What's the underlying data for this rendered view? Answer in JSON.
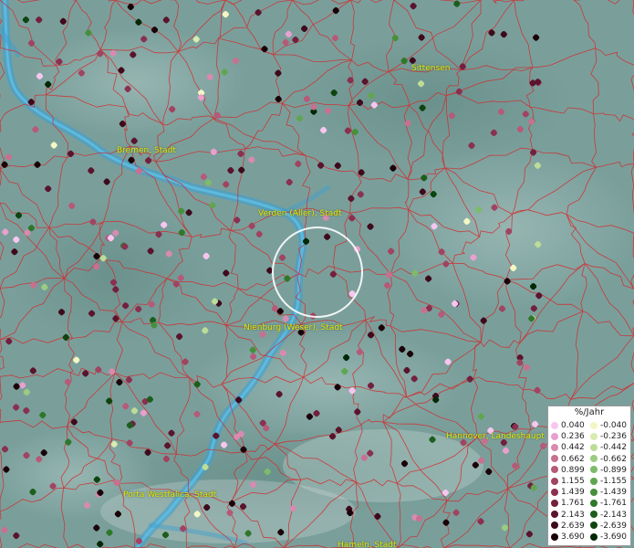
{
  "cities": [
    {
      "id": "sittensen",
      "label": "Sittensen"
    },
    {
      "id": "bremen",
      "label": "Bremen, Stadt"
    },
    {
      "id": "verden",
      "label": "Verden (Aller), Stadt"
    },
    {
      "id": "nienburg",
      "label": "Nienburg (Weser), Stadt"
    },
    {
      "id": "hannover",
      "label": "Hannover, Landeshaupt"
    },
    {
      "id": "porta",
      "label": "Porta Westfalica, Stadt"
    },
    {
      "id": "hameln",
      "label": "Hameln, Stadt"
    }
  ],
  "legend": {
    "title": "%/Jahr",
    "positive": [
      {
        "label": "0.040",
        "color": "#f7c6f0"
      },
      {
        "label": "0.236",
        "color": "#e9a0cf"
      },
      {
        "label": "0.442",
        "color": "#d98ab0"
      },
      {
        "label": "0.662",
        "color": "#c87090"
      },
      {
        "label": "0.899",
        "color": "#b55a78"
      },
      {
        "label": "1.155",
        "color": "#a04462"
      },
      {
        "label": "1.439",
        "color": "#8a3050"
      },
      {
        "label": "1.761",
        "color": "#72203e"
      },
      {
        "label": "2.143",
        "color": "#5a142e"
      },
      {
        "label": "2.639",
        "color": "#3e0a1c"
      },
      {
        "label": "3.690",
        "color": "#1a0008"
      }
    ],
    "negative": [
      {
        "label": "-0.040",
        "color": "#f4f7c4"
      },
      {
        "label": "-0.236",
        "color": "#d8ebb0"
      },
      {
        "label": "-0.442",
        "color": "#bcdc98"
      },
      {
        "label": "-0.662",
        "color": "#9ccc80"
      },
      {
        "label": "-0.899",
        "color": "#7ebb68"
      },
      {
        "label": "-1.155",
        "color": "#60a650"
      },
      {
        "label": "-1.439",
        "color": "#46903c"
      },
      {
        "label": "-1.761",
        "color": "#2e782a"
      },
      {
        "label": "-2.143",
        "color": "#1c5e1c"
      },
      {
        "label": "-2.639",
        "color": "#0e4410"
      },
      {
        "label": "-3.690",
        "color": "#032806"
      }
    ]
  }
}
